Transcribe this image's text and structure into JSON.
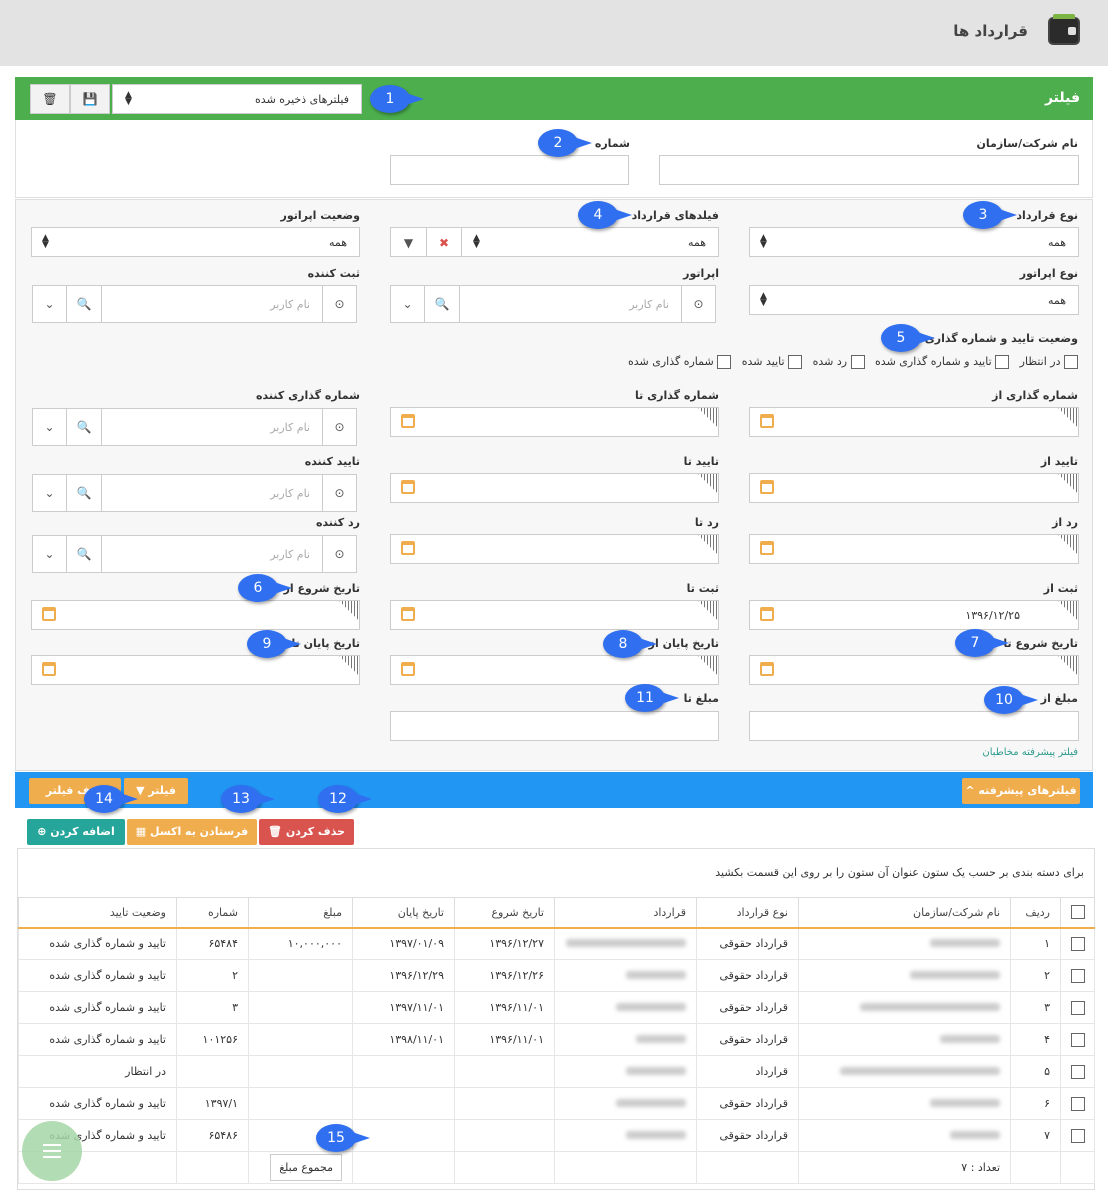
{
  "header": {
    "title": "قرارداد ها"
  },
  "filter": {
    "title": "فیلتر",
    "saved_filters": "فیلترهای ذخیره شده",
    "company_label": "نام شرکت/سازمان",
    "number_label": "شماره"
  },
  "adv": {
    "contract_type": "نوع قرارداد",
    "contract_type_val": "همه",
    "contract_fields": "فیلدهای قرارداد",
    "contract_fields_val": "همه",
    "operator_status": "وضعیت اپراتور",
    "operator_status_val": "همه",
    "operator_type": "نوع اپراتور",
    "operator_type_val": "همه",
    "operator": "اپراتور",
    "registrar": "ثبت کننده",
    "username_ph": "نام کاربر",
    "approval_status": "وضعیت تایید و شماره گذاری",
    "status_opts": [
      "در انتظار",
      "تایید و شماره گذاری شده",
      "رد شده",
      "تایید شده",
      "شماره گذاری شده"
    ],
    "numbering_from": "شماره گذاری از",
    "numbering_to": "شماره گذاری تا",
    "numberer": "شماره گذاری کننده",
    "approve_from": "تایید از",
    "approve_to": "تایید تا",
    "approver": "تایید کننده",
    "reject_from": "رد از",
    "reject_to": "رد تا",
    "rejecter": "رد کننده",
    "reg_from": "ثبت از",
    "reg_from_val": "۱۳۹۶/۱۲/۲۵",
    "reg_to": "ثبت تا",
    "start_from": "تاریخ شروع از",
    "start_to": "تاریخ شروع تا",
    "end_from": "تاریخ پایان از",
    "end_to": "تاریخ پایان تا",
    "amount_from": "مبلغ از",
    "amount_to": "مبلغ تا",
    "audience_link": "فیلتر پیشرفته مخاطبان"
  },
  "bar": {
    "advanced": "^ فیلترهای پیشرفته",
    "filter_btn": "فیلتر",
    "remove_filter": "حذف فیلتر"
  },
  "actions": {
    "delete": "حذف کردن",
    "excel": "فرستادن به اکسل",
    "add": "اضافه کردن"
  },
  "grid": {
    "group_hint": "برای دسته بندی بر حسب یک ستون عنوان آن ستون را بر روی این قسمت بکشید",
    "columns": [
      "ردیف",
      "نام شرکت/سازمان",
      "نوع قرارداد",
      "قرارداد",
      "تاریخ شروع",
      "تاریخ پایان",
      "مبلغ",
      "شماره",
      "وضعیت تایید"
    ],
    "rows": [
      {
        "n": "۱",
        "type": "قرارداد حقوقی",
        "start": "۱۳۹۶/۱۲/۲۷",
        "end": "۱۳۹۷/۰۱/۰۹",
        "amount": "۱۰,۰۰۰,۰۰۰",
        "num": "۶۵۴۸۴",
        "status": "تایید و شماره گذاری شده"
      },
      {
        "n": "۲",
        "type": "قرارداد حقوقی",
        "start": "۱۳۹۶/۱۲/۲۶",
        "end": "۱۳۹۶/۱۲/۲۹",
        "amount": "",
        "num": "۲",
        "status": "تایید و شماره گذاری شده"
      },
      {
        "n": "۳",
        "type": "قرارداد حقوقی",
        "start": "۱۳۹۶/۱۱/۰۱",
        "end": "۱۳۹۷/۱۱/۰۱",
        "amount": "",
        "num": "۳",
        "status": "تایید و شماره گذاری شده"
      },
      {
        "n": "۴",
        "type": "قرارداد حقوقی",
        "start": "۱۳۹۶/۱۱/۰۱",
        "end": "۱۳۹۸/۱۱/۰۱",
        "amount": "",
        "num": "۱۰۱۲۵۶",
        "status": "تایید و شماره گذاری شده"
      },
      {
        "n": "۵",
        "type": "قرارداد",
        "start": "",
        "end": "",
        "amount": "",
        "num": "",
        "status": "در انتظار"
      },
      {
        "n": "۶",
        "type": "قرارداد حقوقی",
        "start": "",
        "end": "",
        "amount": "",
        "num": "۱۳۹۷/۱",
        "status": "تایید و شماره گذاری شده"
      },
      {
        "n": "۷",
        "type": "قرارداد حقوقی",
        "start": "",
        "end": "",
        "amount": "",
        "num": "۶۵۴۸۶",
        "status": "تایید و شماره گذاری شده"
      }
    ],
    "count": "تعداد : ۷",
    "sum_btn": "مجموع مبلغ"
  },
  "badges": [
    "1",
    "2",
    "3",
    "4",
    "5",
    "6",
    "7",
    "8",
    "9",
    "10",
    "11",
    "12",
    "13",
    "14",
    "15"
  ]
}
